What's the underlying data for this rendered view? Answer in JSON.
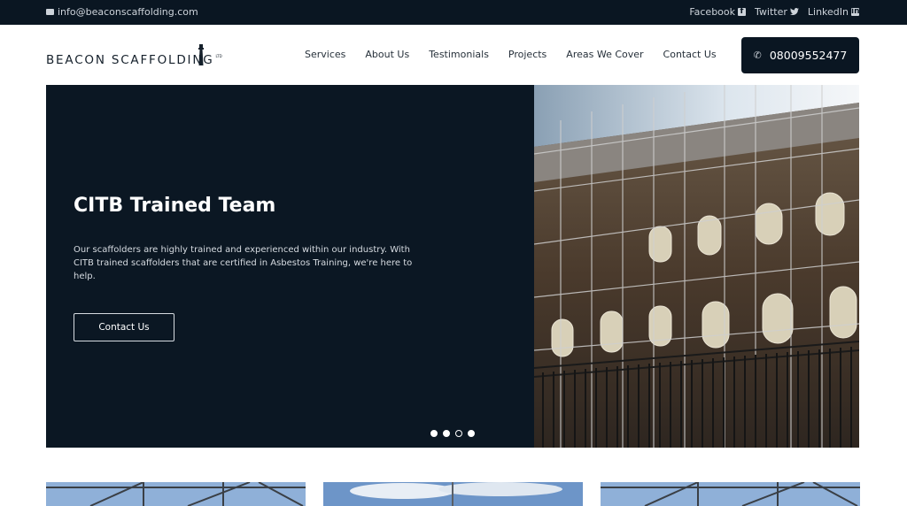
{
  "topbar": {
    "email": "info@beaconscaffolding.com",
    "social": [
      {
        "label": "Facebook",
        "icon": "facebook-icon"
      },
      {
        "label": "Twitter",
        "icon": "twitter-icon"
      },
      {
        "label": "LinkedIn",
        "icon": "linkedin-icon"
      }
    ]
  },
  "header": {
    "logo_text": "BEACON SCAFFOLDING",
    "logo_suffix": "LTD",
    "nav": [
      "Services",
      "About Us",
      "Testimonials",
      "Projects",
      "Areas We Cover",
      "Contact Us"
    ],
    "phone": "08009552477"
  },
  "hero": {
    "title": "CITB Trained Team",
    "text": "Our scaffolders are highly trained and experienced within our industry. With CITB trained scaffolders that are certified in Asbestos Training, we're here to help.",
    "button": "Contact Us",
    "slides_total": 4,
    "active_slide": 3
  },
  "colors": {
    "topbar_bg": "#0a1622",
    "hero_bg": "#0b1723",
    "button_bg": "#0a1622"
  }
}
